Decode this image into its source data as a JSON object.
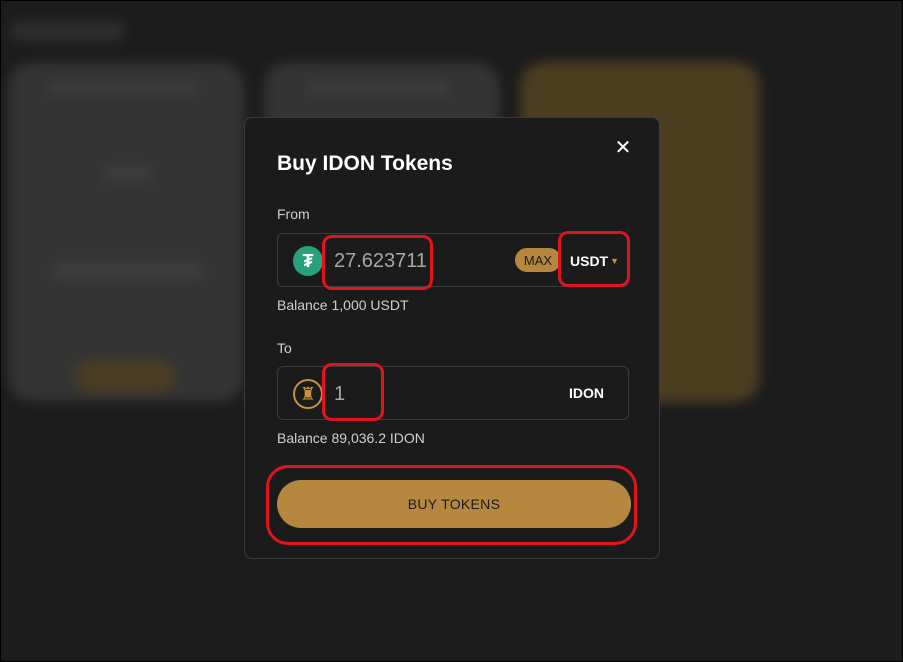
{
  "modal": {
    "title": "Buy IDON Tokens",
    "close_icon": "close-icon",
    "from": {
      "label": "From",
      "amount": "27.623711",
      "max_label": "MAX",
      "currency": "USDT",
      "currency_icon": "usdt-icon",
      "balance": "Balance 1,000 USDT"
    },
    "to": {
      "label": "To",
      "amount": "1",
      "currency": "IDON",
      "currency_icon": "idon-rook-icon",
      "balance": "Balance 89,036.2 IDON"
    },
    "buy_label": "BUY TOKENS"
  },
  "colors": {
    "accent": "#b5873f",
    "modal_bg": "#1b1b1b",
    "usdt_green": "#26a17b",
    "highlight": "#e0141e"
  }
}
